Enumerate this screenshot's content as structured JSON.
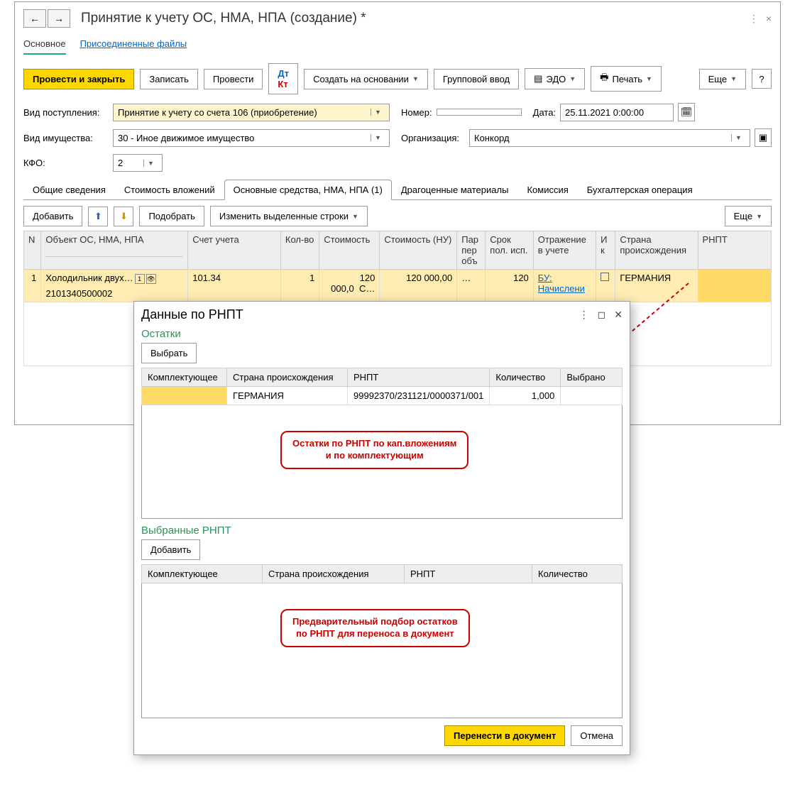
{
  "header": {
    "title": "Принятие к учету ОС, НМА, НПА (создание) *"
  },
  "nav": {
    "main": "Основное",
    "files": "Присоединенные файлы"
  },
  "toolbar": {
    "post_close": "Провести и закрыть",
    "write": "Записать",
    "post": "Провести",
    "create_based": "Создать на основании",
    "group_input": "Групповой ввод",
    "edo": "ЭДО",
    "print": "Печать",
    "more": "Еще",
    "help": "?"
  },
  "form": {
    "receipt_type_label": "Вид поступления:",
    "receipt_type": "Принятие к учету со счета 106 (приобретение)",
    "number_label": "Номер:",
    "number": "",
    "date_label": "Дата:",
    "date": "25.11.2021  0:00:00",
    "prop_type_label": "Вид имущества:",
    "prop_type": "30 - Иное движимое имущество",
    "org_label": "Организация:",
    "org": "Конкорд",
    "kfo_label": "КФО:",
    "kfo": "2"
  },
  "tabs": {
    "t1": "Общие сведения",
    "t2": "Стоимость вложений",
    "t3": "Основные средства, НМА, НПА (1)",
    "t4": "Драгоценные материалы",
    "t5": "Комиссия",
    "t6": "Бухгалтерская операция"
  },
  "subbar": {
    "add": "Добавить",
    "pick": "Подобрать",
    "change_rows": "Изменить выделенные строки",
    "more": "Еще"
  },
  "columns": {
    "n": "N",
    "object": "Объект ОС, НМА, НПА",
    "account": "Счет учета",
    "qty": "Кол-во",
    "cost": "Стоимость",
    "cost_nu": "Стоимость (НУ)",
    "par": "Пар пер объ",
    "term": "Срок пол. исп.",
    "refl": "Отражение в учете",
    "inv": "И к",
    "country": "Страна происхождения",
    "rnpt": "РНПТ"
  },
  "row": {
    "n": "1",
    "object": "Холодильник двух…",
    "inv_no": "2101340500002",
    "account": "101.34",
    "qty": "1",
    "cost": "120 000,0",
    "cost_s": "С…",
    "cost_nu": "120 000,00",
    "dots": "…",
    "term": "120",
    "refl": "БУ: Начислени",
    "country": "ГЕРМАНИЯ"
  },
  "dialog": {
    "title": "Данные по РНПТ",
    "section1": "Остатки",
    "select_btn": "Выбрать",
    "cols": {
      "comp": "Комплектующее",
      "country": "Страна происхождения",
      "rnpt": "РНПТ",
      "qty": "Количество",
      "chosen": "Выбрано"
    },
    "data_row": {
      "country": "ГЕРМАНИЯ",
      "rnpt": "99992370/231121/0000371/001",
      "qty": "1,000"
    },
    "callout1_l1": "Остатки по РНПТ по кап.вложениям",
    "callout1_l2": "и по комплектующим",
    "section2": "Выбранные РНПТ",
    "add_btn": "Добавить",
    "cols2": {
      "comp": "Комплектующее",
      "country": "Страна происхождения",
      "rnpt": "РНПТ",
      "qty": "Количество"
    },
    "callout2_l1": "Предварительный подбор остатков",
    "callout2_l2": "по РНПТ для переноса в документ",
    "footer_ok": "Перенести в документ",
    "footer_cancel": "Отмена"
  }
}
